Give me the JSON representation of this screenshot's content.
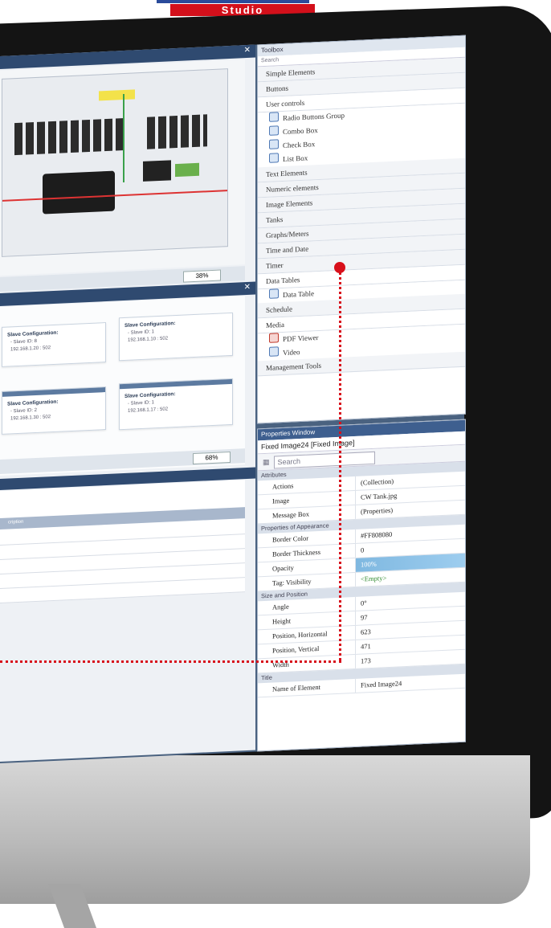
{
  "brand": {
    "subtitle": "Studio"
  },
  "canvas": {
    "zoom": "38%"
  },
  "config": {
    "cards": [
      {
        "title": "Slave Configuration:",
        "lines": [
          "- Slave ID: 8",
          "192.168.1.20 : 502"
        ]
      },
      {
        "title": "Slave Configuration:",
        "lines": [
          "- Slave ID: 1",
          "192.168.1.10 : 502"
        ]
      },
      {
        "title": "Slave Configuration:",
        "lines": [
          "- Slave ID: 2",
          "192.168.1.30 : 502"
        ]
      },
      {
        "title": "Slave Configuration:",
        "lines": [
          "- Slave ID: 1",
          "192.168.1.17 : 502"
        ]
      }
    ],
    "zoom": "68%"
  },
  "grid": {
    "header": "cription"
  },
  "toolbox": {
    "title": "Toolbox",
    "search_placeholder": "Search",
    "categories": [
      "Simple Elements",
      "Buttons",
      "User controls",
      "Text Elements",
      "Numeric elements",
      "Image Elements",
      "Tanks",
      "Graphs/Meters",
      "Time and Date",
      "Timer",
      "Data Tables",
      "Schedule",
      "Media",
      "Management Tools"
    ],
    "user_controls": [
      "Radio Buttons Group",
      "Combo Box",
      "Check Box",
      "List Box"
    ],
    "data_tables": [
      "Data Table"
    ],
    "media": [
      "PDF Viewer",
      "Video"
    ]
  },
  "properties": {
    "title": "Properties Window",
    "object": "Fixed Image24 [Fixed Image]",
    "search_placeholder": "Search",
    "sections": [
      {
        "name": "Attributes",
        "rows": [
          {
            "k": "Actions",
            "v": "(Collection)"
          },
          {
            "k": "Image",
            "v": "CW Tank.jpg"
          },
          {
            "k": "Message Box",
            "v": "(Properties)"
          }
        ]
      },
      {
        "name": "Properties of Appearance",
        "rows": [
          {
            "k": "Border Color",
            "v": "#FF808080"
          },
          {
            "k": "Border Thickness",
            "v": "0"
          },
          {
            "k": "Opacity",
            "v": "100%"
          },
          {
            "k": "Tag: Visibility",
            "v": "<Empty>"
          }
        ]
      },
      {
        "name": "Size and Position",
        "rows": [
          {
            "k": "Angle",
            "v": "0°"
          },
          {
            "k": "Height",
            "v": "97"
          },
          {
            "k": "Position, Horizontal",
            "v": "623"
          },
          {
            "k": "Position, Vertical",
            "v": "471"
          },
          {
            "k": "Width",
            "v": "173"
          }
        ]
      },
      {
        "name": "Title",
        "rows": [
          {
            "k": "Name of Element",
            "v": "Fixed Image24"
          }
        ]
      }
    ]
  },
  "colors": {
    "accent": "#d8101b",
    "panel_header": "#2f4a70",
    "brand_blue": "#2a4b9b"
  }
}
